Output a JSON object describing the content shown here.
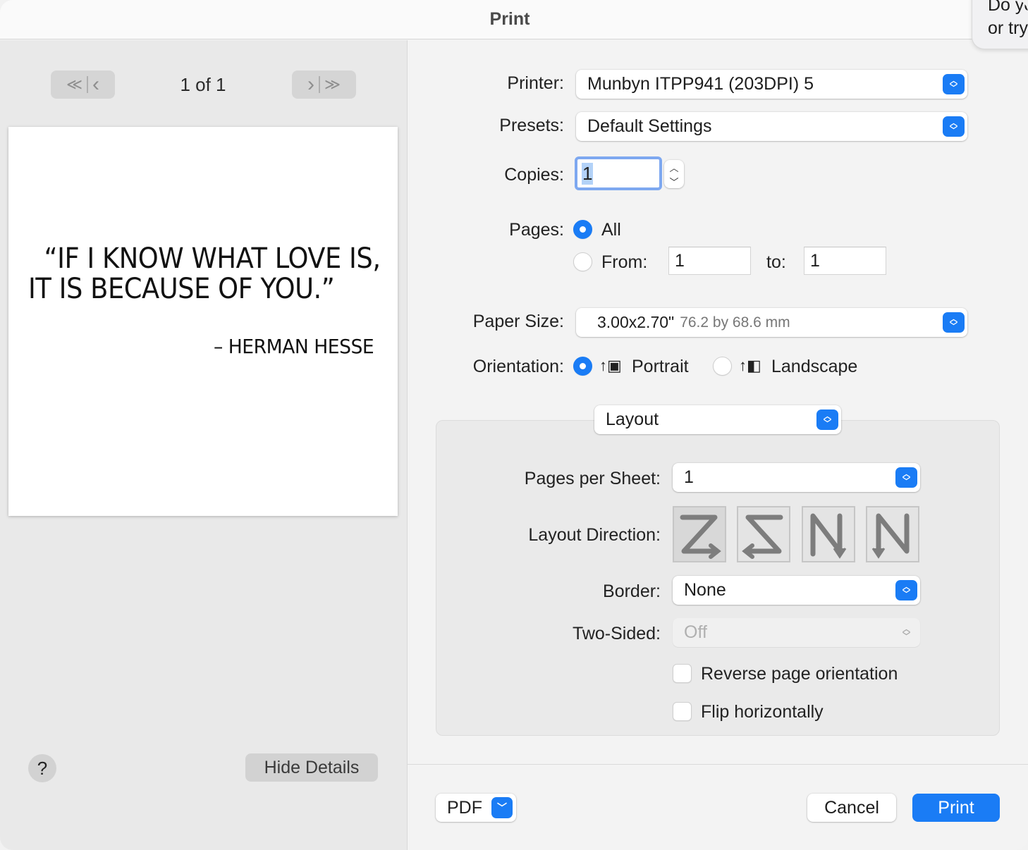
{
  "window": {
    "title": "Print"
  },
  "tooltip": {
    "text": "Do yo\nor try"
  },
  "preview": {
    "page_indicator": "1 of 1",
    "nav_first": "≪",
    "nav_prev": "‹",
    "nav_next": "›",
    "nav_last": "≫",
    "quote_text": "  “IF I KNOW WHAT LOVE IS,\nIT IS BECAUSE OF YOU.”",
    "quote_author": "– HERMAN HESSE",
    "help_label": "?",
    "hide_details_label": "Hide Details"
  },
  "settings": {
    "printer": {
      "label": "Printer:",
      "value": "Munbyn ITPP941 (203DPI) 5"
    },
    "presets": {
      "label": "Presets:",
      "value": "Default Settings"
    },
    "copies": {
      "label": "Copies:",
      "value": "1"
    },
    "pages": {
      "label": "Pages:",
      "all_label": "All",
      "all_selected": true,
      "from_label": "From:",
      "from_value": "1",
      "to_label": "to:",
      "to_value": "1"
    },
    "paper_size": {
      "label": "Paper Size:",
      "value": "3.00x2.70\"",
      "metric": "76.2 by 68.6 mm"
    },
    "orientation": {
      "label": "Orientation:",
      "portrait_label": "Portrait",
      "landscape_label": "Landscape",
      "selected": "Portrait"
    },
    "section_popup": {
      "value": "Layout"
    },
    "layout": {
      "pages_per_sheet": {
        "label": "Pages per Sheet:",
        "value": "1"
      },
      "layout_direction": {
        "label": "Layout Direction:",
        "options": [
          "Z",
          "reverse-Z",
          "N-reverse",
          "N"
        ],
        "selected": 0
      },
      "border": {
        "label": "Border:",
        "value": "None"
      },
      "two_sided": {
        "label": "Two-Sided:",
        "value": "Off",
        "disabled": true
      },
      "reverse_page_orientation": {
        "label": "Reverse page orientation",
        "checked": false
      },
      "flip_horizontally": {
        "label": "Flip horizontally",
        "checked": false
      }
    }
  },
  "footer": {
    "pdf_label": "PDF",
    "cancel_label": "Cancel",
    "print_label": "Print"
  },
  "colors": {
    "accent": "#1a7cf5"
  }
}
